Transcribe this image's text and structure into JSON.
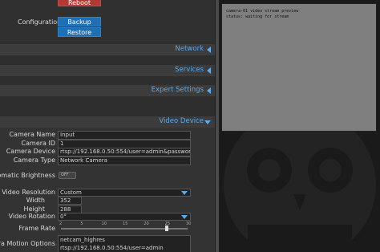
{
  "top": {
    "reboot_label": "Reboot",
    "configuration_label": "Configuration",
    "backup_label": "Backup",
    "restore_label": "Restore"
  },
  "sections": {
    "network": "Network",
    "services": "Services",
    "expert_settings": "Expert Settings",
    "video_device": "Video Device"
  },
  "device": {
    "camera_name_label": "Camera Name",
    "camera_name_value": "Input",
    "camera_id_label": "Camera ID",
    "camera_id_value": "1",
    "camera_device_label": "Camera Device",
    "camera_device_value": "rtsp://192.168.0.50:554/user=admin&password=&ch",
    "camera_type_label": "Camera Type",
    "camera_type_value": "Network Camera",
    "auto_brightness_label": "Automatic Brightness",
    "auto_brightness_state": "OFF",
    "video_resolution_label": "Video Resolution",
    "video_resolution_value": "Custom",
    "width_label": "Width",
    "width_value": "352",
    "height_label": "Height",
    "height_value": "288",
    "video_rotation_label": "Video Rotation",
    "video_rotation_value": "0°",
    "frame_rate_label": "Frame Rate",
    "frame_rate_value": 25,
    "frame_rate_ticks": [
      "2",
      "5",
      "10",
      "15",
      "20",
      "25",
      "30"
    ],
    "extra_motion_label": "Extra Motion Options",
    "extra_motion_value": "netcam_highres rtsp://192.168.0.50:554/user=admin"
  },
  "preview": {
    "overlay_line1": "camera-01 video stream preview",
    "overlay_line2": "status: waiting for stream"
  },
  "colors": {
    "accent": "#5ea9e8",
    "button_blue": "#1f6fb3",
    "button_red": "#b23a34"
  }
}
